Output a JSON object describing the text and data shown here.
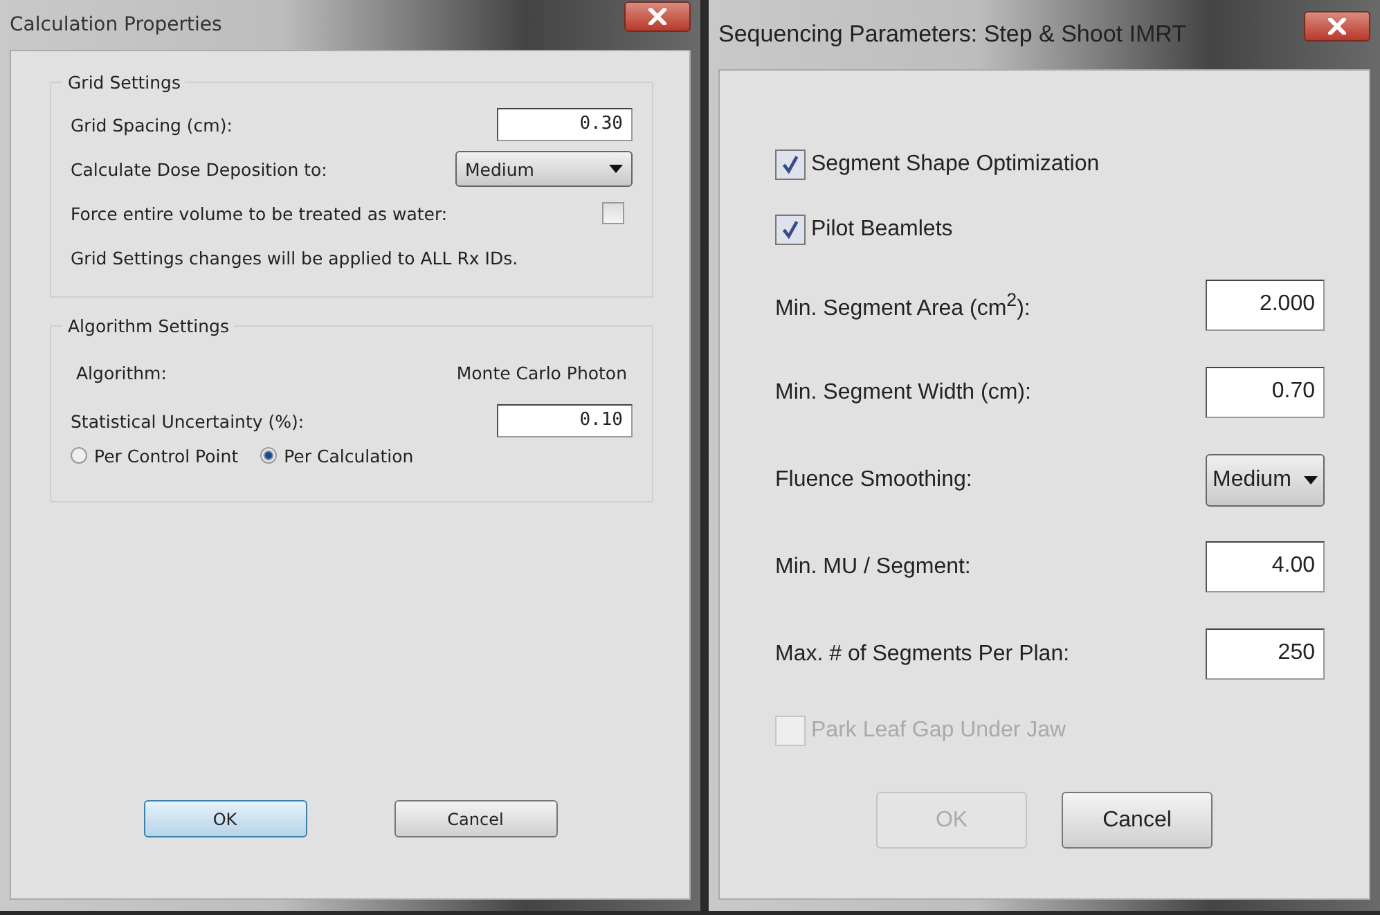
{
  "dialogs": [
    {
      "title": "Calculation Properties",
      "groups": [
        {
          "title": "Grid Settings",
          "rows": [
            {
              "kind": "field",
              "label": "Grid Spacing (cm):",
              "value": "0.30"
            },
            {
              "kind": "dropdown",
              "label": "Calculate Dose Deposition to:",
              "value": "Medium"
            },
            {
              "kind": "check_after",
              "label": "Force entire volume to be treated as water:",
              "checked": false
            },
            {
              "kind": "note",
              "text": "Grid Settings changes will be applied to ALL Rx IDs."
            }
          ]
        },
        {
          "title": "Algorithm Settings",
          "rows": [
            {
              "kind": "info",
              "label": "Algorithm:",
              "value": "Monte Carlo Photon"
            },
            {
              "kind": "field",
              "label": "Statistical Uncertainty (%):",
              "value": "0.10"
            },
            {
              "kind": "radios",
              "options": [
                {
                  "label": "Per Control Point",
                  "selected": false
                },
                {
                  "label": "Per Calculation",
                  "selected": true
                }
              ]
            }
          ]
        }
      ],
      "buttons": [
        {
          "label": "OK",
          "default": true,
          "disabled": false
        },
        {
          "label": "Cancel",
          "default": false,
          "disabled": false
        }
      ]
    },
    {
      "title": "Sequencing Parameters: Step & Shoot IMRT",
      "groups": [
        {
          "rows": [
            {
              "kind": "check",
              "label": "Segment Shape Optimization",
              "checked": true,
              "disabled": false
            },
            {
              "kind": "check",
              "label": "Pilot Beamlets",
              "checked": true,
              "disabled": false
            },
            {
              "kind": "field",
              "label": "Min. Segment Area (cm$^{2}$):",
              "value": "2.000"
            },
            {
              "kind": "field",
              "label": "Min. Segment Width (cm):",
              "value": "0.70"
            },
            {
              "kind": "dropdown",
              "label": "Fluence Smoothing:",
              "value": "Medium"
            },
            {
              "kind": "field",
              "label": "Min. MU / Segment:",
              "value": "4.00"
            },
            {
              "kind": "field",
              "label": "Max. # of Segments Per Plan:",
              "value": "250"
            },
            {
              "kind": "check",
              "label": "Park Leaf Gap Under Jaw",
              "checked": false,
              "disabled": true
            }
          ]
        }
      ],
      "buttons": [
        {
          "label": "OK",
          "default": false,
          "disabled": true
        },
        {
          "label": "Cancel",
          "default": false,
          "disabled": false
        }
      ]
    }
  ]
}
